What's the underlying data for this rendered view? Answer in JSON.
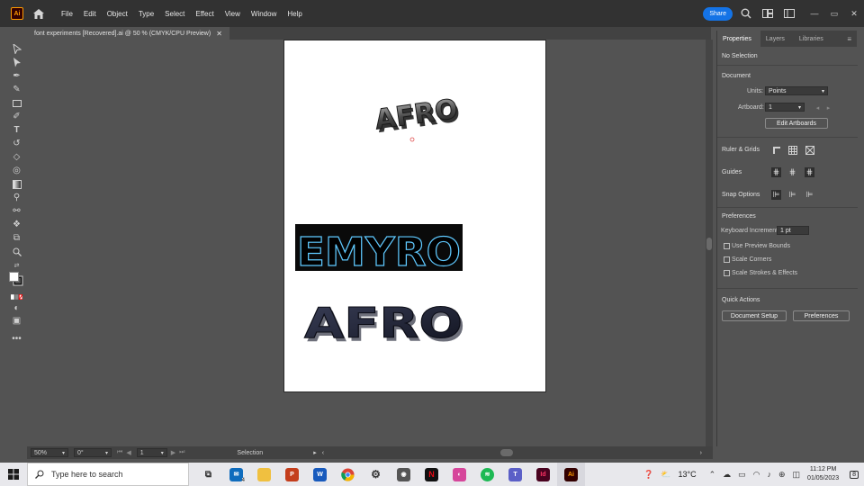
{
  "app": {
    "logo": "Ai",
    "menu": [
      "File",
      "Edit",
      "Object",
      "Type",
      "Select",
      "Effect",
      "View",
      "Window",
      "Help"
    ],
    "share_label": "Share"
  },
  "document": {
    "tab_title": "font experiments [Recovered].ai @ 50 % (CMYK/CPU Preview)"
  },
  "artwork": {
    "text1": "AFRO",
    "text2": "EMYRO",
    "text3": "AFRO"
  },
  "status": {
    "zoom": "50%",
    "rotation": "0°",
    "artboard_num": "1",
    "tool": "Selection"
  },
  "panel": {
    "tabs": [
      "Properties",
      "Layers",
      "Libraries"
    ],
    "no_selection": "No Selection",
    "document_heading": "Document",
    "units_label": "Units:",
    "units_value": "Points",
    "artboard_label": "Artboard:",
    "artboard_value": "1",
    "edit_artboards": "Edit Artboards",
    "ruler_grids": "Ruler & Grids",
    "guides": "Guides",
    "snap_options": "Snap Options",
    "preferences_heading": "Preferences",
    "keyboard_increment_label": "Keyboard Increment:",
    "keyboard_increment_value": "1 pt",
    "use_preview_bounds": "Use Preview Bounds",
    "scale_corners": "Scale Corners",
    "scale_strokes": "Scale Strokes & Effects",
    "quick_actions": "Quick Actions",
    "document_setup": "Document Setup",
    "preferences_button": "Preferences"
  },
  "taskbar": {
    "search_placeholder": "Type here to search",
    "weather": "13°C",
    "time": "11:12 PM",
    "date": "01/05/2023",
    "mail_badge": "4",
    "notification_badge": "8"
  }
}
